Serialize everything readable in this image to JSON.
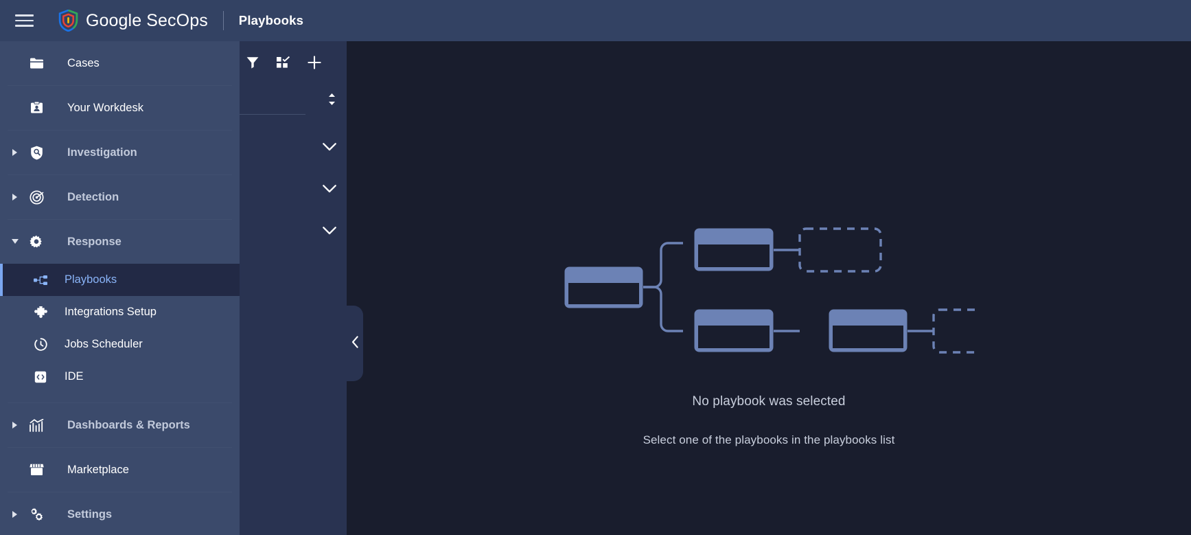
{
  "topbar": {
    "menu_icon": "hamburger-menu-icon",
    "logo_icon": "google-secops-shield-icon",
    "brand_google": "Google",
    "brand_secops": "SecOps",
    "page_title": "Playbooks"
  },
  "sidebar": {
    "items": [
      {
        "label": "Cases",
        "icon": "folder-icon",
        "type": "item",
        "expandable": false
      },
      {
        "label": "Your Workdesk",
        "icon": "workdesk-badge-icon",
        "type": "item",
        "expandable": false
      },
      {
        "label": "Investigation",
        "icon": "shield-search-icon",
        "type": "group",
        "expandable": true,
        "expanded": false
      },
      {
        "label": "Detection",
        "icon": "radar-target-icon",
        "type": "group",
        "expandable": true,
        "expanded": false
      },
      {
        "label": "Response",
        "icon": "gear-icon",
        "type": "group",
        "expandable": true,
        "expanded": true
      },
      {
        "label": "Dashboards & Reports",
        "icon": "chart-trend-icon",
        "type": "group",
        "expandable": true,
        "expanded": false
      },
      {
        "label": "Marketplace",
        "icon": "storefront-icon",
        "type": "item",
        "expandable": false
      },
      {
        "label": "Settings",
        "icon": "multi-gear-icon",
        "type": "group",
        "expandable": true,
        "expanded": false
      }
    ],
    "response_children": [
      {
        "label": "Playbooks",
        "icon": "playbook-nodes-icon",
        "active": true
      },
      {
        "label": "Integrations Setup",
        "icon": "puzzle-piece-icon",
        "active": false
      },
      {
        "label": "Jobs Scheduler",
        "icon": "clock-timer-icon",
        "active": false
      },
      {
        "label": "IDE",
        "icon": "code-brackets-icon",
        "active": false
      }
    ],
    "active_item": "Playbooks"
  },
  "list_panel": {
    "toolbar": [
      {
        "icon": "filter-funnel-icon",
        "name": "filter-button"
      },
      {
        "icon": "multi-select-grid-icon",
        "name": "multi-select-button"
      },
      {
        "icon": "plus-icon",
        "name": "add-playbook-button"
      }
    ],
    "sort_icon": "sort-updown-icon",
    "section_toggles": [
      {
        "icon": "chevron-down-icon"
      },
      {
        "icon": "chevron-down-icon"
      },
      {
        "icon": "chevron-down-icon"
      }
    ],
    "collapse_handle_icon": "chevron-left-icon"
  },
  "main": {
    "illustration": "playbook-flow-diagram-illustration",
    "empty_title": "No playbook was selected",
    "empty_subtitle": "Select one of the playbooks in the playbooks list"
  },
  "colors": {
    "topbar_bg": "#334263",
    "sidebar_bg": "#3b4a6b",
    "list_panel_bg": "#293351",
    "main_bg": "#191d2d",
    "active_item_bg": "#222945",
    "accent_blue": "#8ab4f8",
    "illustration_blue": "#6c82b5",
    "text_primary": "#ffffff",
    "text_muted": "#c9cfdd"
  }
}
